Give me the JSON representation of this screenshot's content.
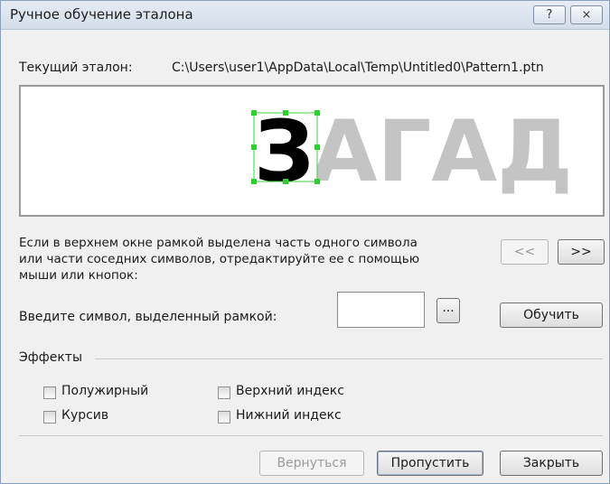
{
  "window": {
    "title": "Ручное обучение эталона",
    "help_label": "?",
    "close_label": "⨯"
  },
  "pattern": {
    "label": "Текущий эталон:",
    "path": "C:\\Users\\user1\\AppData\\Local\\Temp\\Untitled0\\Pattern1.ptn"
  },
  "preview": {
    "text": "ЗАГАД",
    "selected_char": "З"
  },
  "instructions": [
    "Если в верхнем окне рамкой выделена часть одного символа",
    "или части соседних символов, отредактируйте ее с помощью",
    "мыши или кнопок:"
  ],
  "nav": {
    "prev_label": "<<",
    "next_label": ">>"
  },
  "input": {
    "label": "Введите символ, выделенный рамкой:",
    "value": "",
    "browse_label": "...",
    "train_label": "Обучить"
  },
  "effects": {
    "title": "Эффекты",
    "options": [
      {
        "label": "Полужирный",
        "checked": false
      },
      {
        "label": "Курсив",
        "checked": false
      },
      {
        "label": "Верхний индекс",
        "checked": false
      },
      {
        "label": "Нижний индекс",
        "checked": false
      }
    ]
  },
  "footer": {
    "back_label": "Вернуться",
    "skip_label": "Пропустить",
    "close_label": "Закрыть"
  }
}
